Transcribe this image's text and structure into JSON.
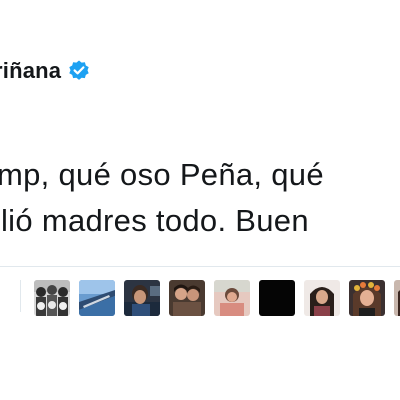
{
  "tweet": {
    "author_name": "riñana",
    "verified": true,
    "handle_fragment": "",
    "text_line_1": "mp, qué oso Peña, qué",
    "text_line_2": "lió madres todo. Buen"
  },
  "likers": [
    {
      "icon": "avatar-group-bw"
    },
    {
      "icon": "avatar-airplane-wing"
    },
    {
      "icon": "avatar-person-dark"
    },
    {
      "icon": "avatar-couple"
    },
    {
      "icon": "avatar-person-pink"
    },
    {
      "icon": "avatar-black"
    },
    {
      "icon": "avatar-person-hair"
    },
    {
      "icon": "avatar-person-flowers"
    },
    {
      "icon": "avatar-person-selfie"
    }
  ],
  "colors": {
    "text": "#14171a",
    "secondary": "#8899a6",
    "verified_blue": "#1da1f2",
    "divider": "#e1e8ed"
  }
}
